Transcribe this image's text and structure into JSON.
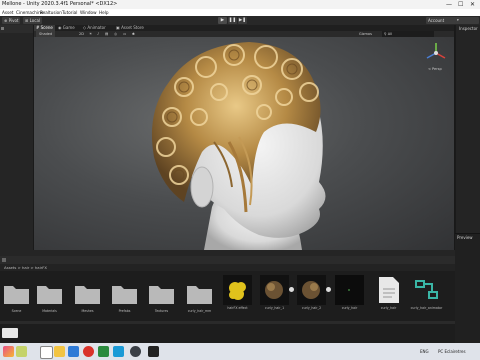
{
  "window": {
    "title": "Mellone - Unity 2020.3.4f1 Personal* <DX12>",
    "controls": [
      "—",
      "☐",
      "✕"
    ]
  },
  "menu": [
    "Asset",
    "Cinemachine",
    "Realtusion",
    "Tutorial",
    "Window",
    "Help"
  ],
  "toolbar": {
    "pivot": "Pivot",
    "local": "Local",
    "play": "▶",
    "pause": "❚❚",
    "step": "▶❚",
    "account": "Account"
  },
  "view_tabs": [
    "Scene",
    "Game",
    "Animator",
    "Asset Store"
  ],
  "scene_bar": {
    "shading": "Shaded",
    "mode_2d": "2D",
    "gizmos": "Gizmos",
    "search": "All"
  },
  "gizmo": {
    "label": "< Persp"
  },
  "inspector": {
    "title": "Inspector"
  },
  "preview": {
    "title": "Preview"
  },
  "project": {
    "breadcrumb": "Assets > hair > hairFX"
  },
  "assets": [
    {
      "label": "Scene",
      "kind": "folder"
    },
    {
      "label": "Materials",
      "kind": "folder"
    },
    {
      "label": "Meshes",
      "kind": "folder"
    },
    {
      "label": "Prefabs",
      "kind": "folder"
    },
    {
      "label": "Textures",
      "kind": "folder"
    },
    {
      "label": "curly_hair_mm",
      "kind": "folder"
    },
    {
      "label": "hairFX effect",
      "kind": "yellow"
    },
    {
      "label": "curly_hair_1",
      "kind": "hair"
    },
    {
      "label": "curly_hair_2",
      "kind": "hair"
    },
    {
      "label": "curly_hair",
      "kind": "dark"
    },
    {
      "label": "curly_hair",
      "kind": "doc"
    },
    {
      "label": "curly_hair_animator",
      "kind": "graph"
    }
  ],
  "taskbar": {
    "lang": "ENG",
    "status": "PC  Eclairetres"
  },
  "colors": {
    "accent": "#4a7fc2",
    "playbtn": "#3a3a3a",
    "panel": "#252525",
    "taskbar": "#dfe3ea"
  }
}
